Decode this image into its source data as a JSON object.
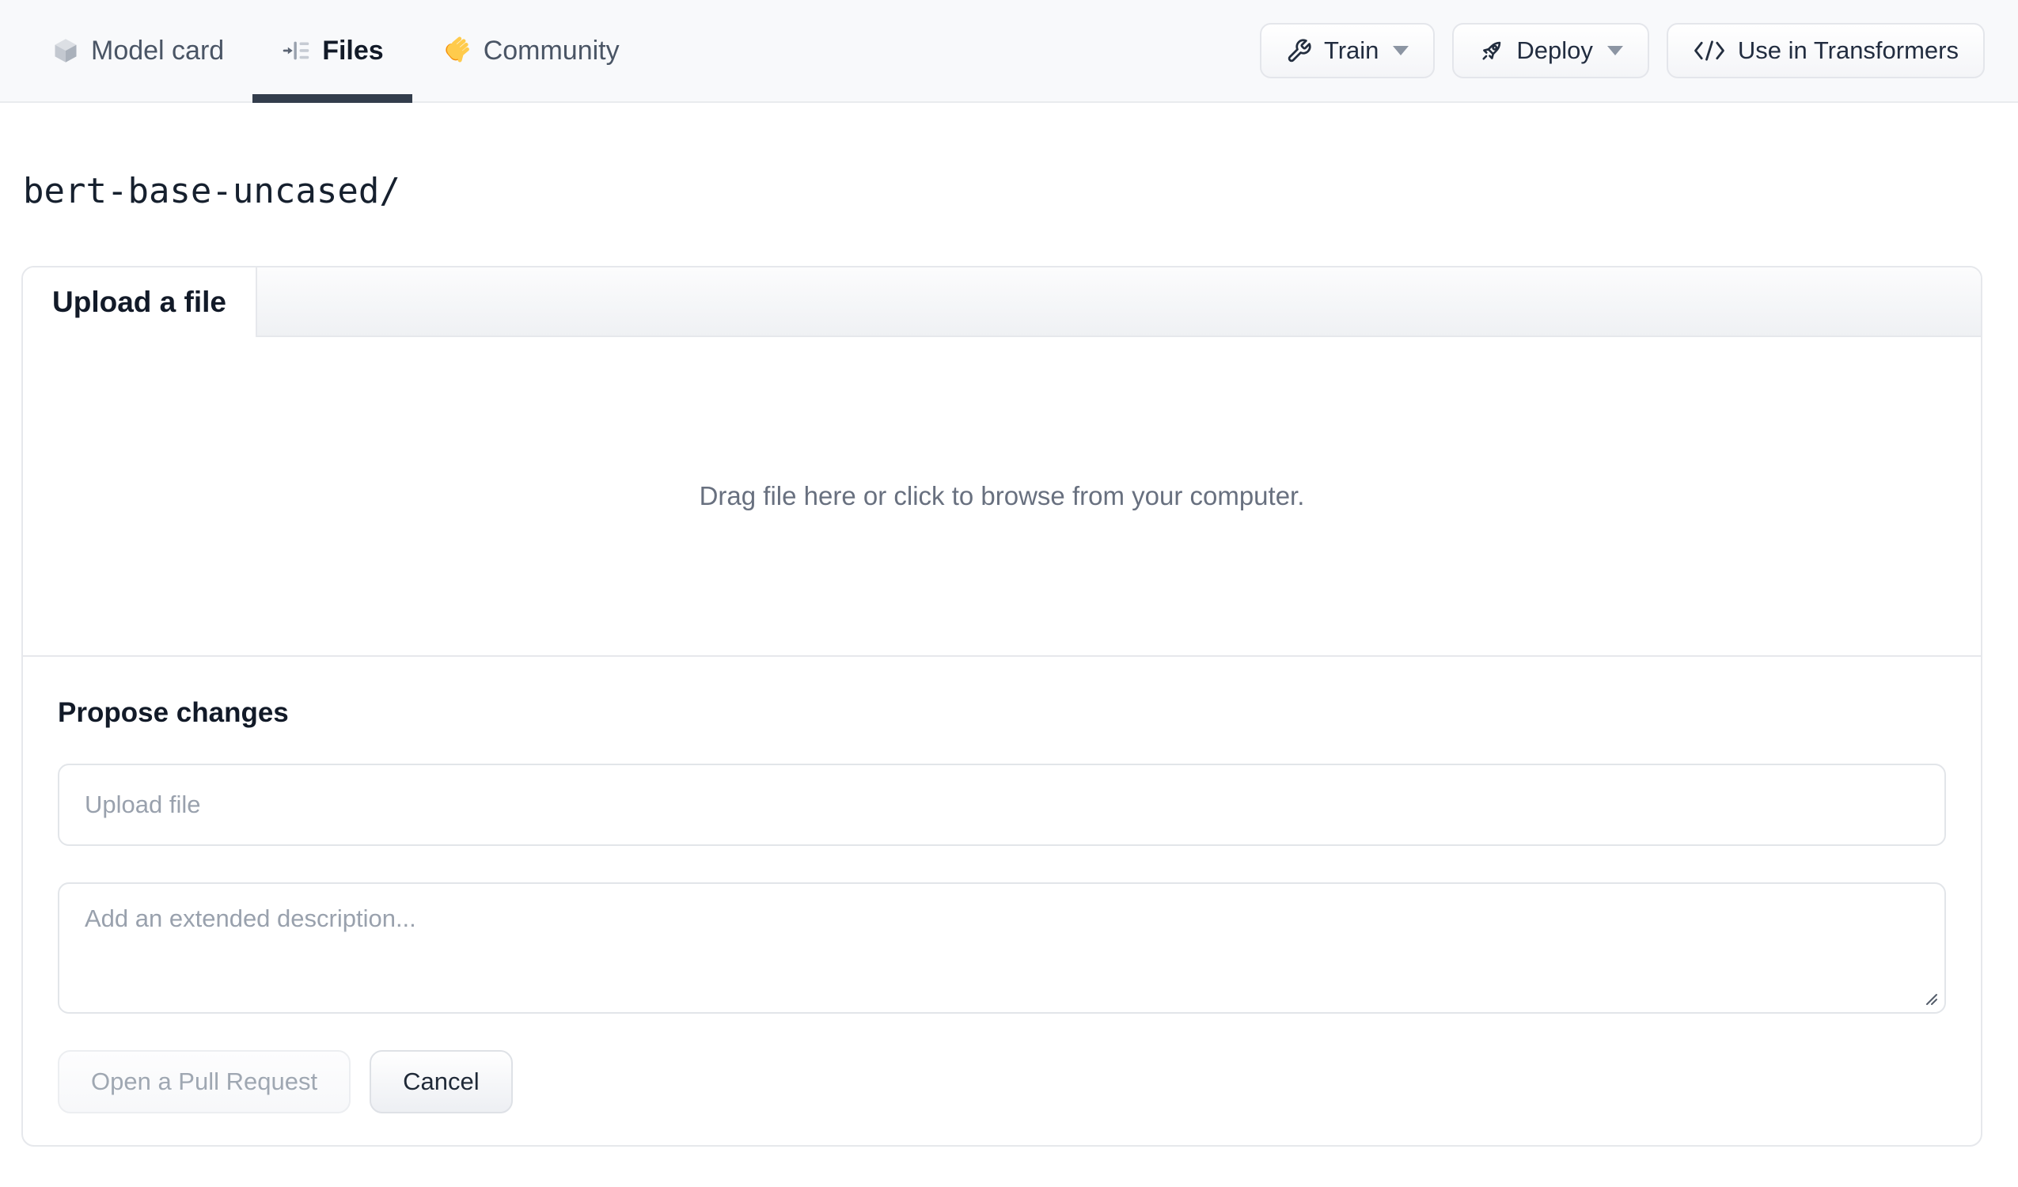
{
  "header": {
    "tabs": [
      {
        "label": "Model card",
        "icon": "cube-icon",
        "active": false
      },
      {
        "label": "Files",
        "icon": "files-icon",
        "active": true
      },
      {
        "label": "Community",
        "icon": "waving-hand-icon",
        "active": false
      }
    ],
    "actions": [
      {
        "label": "Train",
        "icon": "wrench-icon",
        "has_dropdown": true
      },
      {
        "label": "Deploy",
        "icon": "rocket-icon",
        "has_dropdown": true
      },
      {
        "label": "Use in Transformers",
        "icon": "code-icon",
        "has_dropdown": false
      }
    ]
  },
  "breadcrumb": {
    "path": "bert-base-uncased/"
  },
  "upload_panel": {
    "tab_label": "Upload a file",
    "dropzone_text": "Drag file here or click to browse from your computer.",
    "propose": {
      "heading": "Propose changes",
      "filename_placeholder": "Upload file",
      "description_placeholder": "Add an extended description...",
      "submit_label": "Open a Pull Request",
      "submit_disabled": true,
      "cancel_label": "Cancel"
    }
  },
  "colors": {
    "header_bg": "#f8f9fb",
    "active_tab_underline": "#333d4c",
    "card_border": "#e6e8ec",
    "muted_text": "#68707f",
    "placeholder_text": "#99a1ad",
    "disabled_button_text": "#9fa7b2",
    "emoji_yellow": "#FFCB4C",
    "emoji_orange": "#F4900C",
    "dark_text": "#121a28"
  }
}
